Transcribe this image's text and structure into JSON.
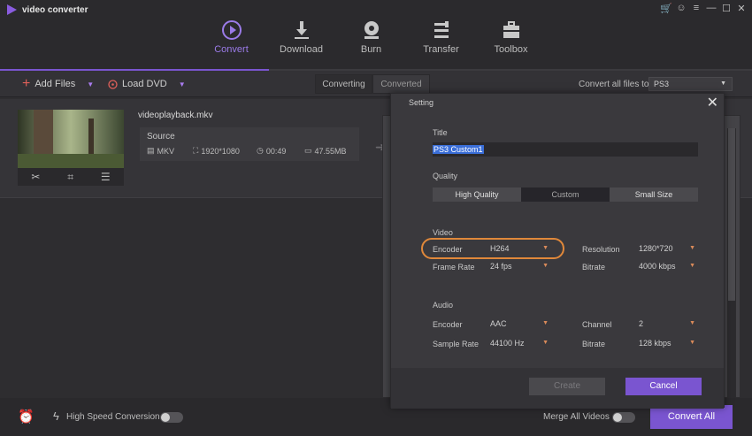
{
  "app": {
    "title": "video converter"
  },
  "nav": [
    {
      "label": "Convert",
      "active": true,
      "icon": "play-circle-icon"
    },
    {
      "label": "Download",
      "active": false,
      "icon": "download-icon"
    },
    {
      "label": "Burn",
      "active": false,
      "icon": "disc-icon"
    },
    {
      "label": "Transfer",
      "active": false,
      "icon": "transfer-icon"
    },
    {
      "label": "Toolbox",
      "active": false,
      "icon": "toolbox-icon"
    }
  ],
  "toolbar": {
    "add_files": "Add Files",
    "load_dvd": "Load DVD",
    "tab_converting": "Converting",
    "tab_converted": "Converted",
    "convert_all_to": "Convert all files to:",
    "format": "PS3"
  },
  "file": {
    "name": "videoplayback.mkv",
    "source_label": "Source",
    "format": "MKV",
    "resolution": "1920*1080",
    "duration": "00:49",
    "size": "47.55MB"
  },
  "bottom": {
    "high_speed": "High Speed Conversion",
    "merge_all": "Merge All Videos",
    "convert_all": "Convert All"
  },
  "dialog": {
    "title": "Setting",
    "title_section": "Title",
    "title_value": "PS3 Custom1",
    "quality_section": "Quality",
    "quality_options": [
      "High Quality",
      "Custom",
      "Small Size"
    ],
    "quality_selected": "Custom",
    "video_section": "Video",
    "video": {
      "encoder_label": "Encoder",
      "encoder": "H264",
      "frame_rate_label": "Frame Rate",
      "frame_rate": "24 fps",
      "resolution_label": "Resolution",
      "resolution": "1280*720",
      "bitrate_label": "Bitrate",
      "bitrate": "4000 kbps"
    },
    "audio_section": "Audio",
    "audio": {
      "encoder_label": "Encoder",
      "encoder": "AAC",
      "sample_rate_label": "Sample Rate",
      "sample_rate": "44100 Hz",
      "channel_label": "Channel",
      "channel": "2",
      "bitrate_label": "Bitrate",
      "bitrate": "128 kbps"
    },
    "create": "Create",
    "cancel": "Cancel"
  },
  "colors": {
    "accent": "#7a55d0",
    "highlight": "#e0883a"
  }
}
